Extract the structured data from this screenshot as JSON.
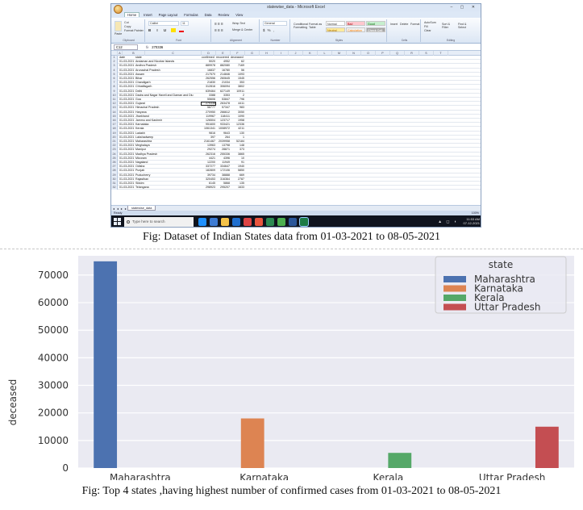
{
  "excel": {
    "window_title": "statewise_data - Microsoft Excel",
    "window_buttons": "– ▢ ✕",
    "ribbon_tabs": [
      "Home",
      "Insert",
      "Page Layout",
      "Formulas",
      "Data",
      "Review",
      "View"
    ],
    "ribbon": {
      "paste": "Paste",
      "cut": "Cut",
      "copy": "Copy",
      "format_painter": "Format Painter",
      "font_name": "Calibri",
      "font_size": "11",
      "wrap_text": "Wrap Text",
      "merge_center": "Merge & Center",
      "number_format": "General",
      "conditional_formatting": "Conditional Formatting",
      "format_as_table": "Format as Table",
      "styles": [
        "Normal",
        "Bad",
        "Good",
        "Neutral",
        "Calculation",
        "Check Cell"
      ],
      "insert": "Insert",
      "delete": "Delete",
      "format": "Format",
      "autosum": "AutoSum",
      "fill": "Fill",
      "clear": "Clear",
      "sort_filter": "Sort & Filter",
      "find_select": "Find & Select",
      "groups": [
        "Clipboard",
        "Font",
        "Alignment",
        "Number",
        "Styles",
        "Cells",
        "Editing"
      ]
    },
    "name_box": "C12",
    "formula_fx": "fx",
    "formula_value": "270336",
    "columns": [
      "A",
      "B",
      "C",
      "D",
      "E",
      "F",
      "G",
      "H",
      "I",
      "J",
      "K",
      "L",
      "M",
      "N",
      "O",
      "P",
      "Q",
      "R",
      "S",
      "T"
    ],
    "header_row": [
      "date",
      "state",
      "confirmed",
      "recovered",
      "deceased"
    ],
    "rows": [
      [
        "01-03-2021",
        "Andaman and Nicobar Islands",
        "5020",
        "4952",
        "62"
      ],
      [
        "01-03-2021",
        "Andhra Pradesh",
        "889978",
        "882080",
        "7169"
      ],
      [
        "01-03-2021",
        "Arunachal Pradesh",
        "16837",
        "16780",
        "56"
      ],
      [
        "01-03-2021",
        "Assam",
        "217570",
        "214846",
        "1093"
      ],
      [
        "01-03-2021",
        "Bihar",
        "262556",
        "260645",
        "1545"
      ],
      [
        "01-03-2021",
        "Chandigarh",
        "21830",
        "21034",
        "353"
      ],
      [
        "01-03-2021",
        "Chhattisgarh",
        "312816",
        "306094",
        "3802"
      ],
      [
        "01-03-2021",
        "Delhi",
        "639464",
        "627149",
        "10911"
      ],
      [
        "01-03-2021",
        "Dadra and Nagar Haveli and Daman and Diu",
        "3388",
        "3353",
        "2"
      ],
      [
        "01-03-2021",
        "Goa",
        "55606",
        "53847",
        "796"
      ],
      [
        "01-03-2021",
        "Gujarat",
        "270336",
        "263478",
        "4411"
      ],
      [
        "01-03-2021",
        "Himachal Pradesh",
        "58777",
        "57347",
        "983"
      ],
      [
        "01-03-2021",
        "Haryana",
        "270950",
        "266612",
        "3050"
      ],
      [
        "01-03-2021",
        "Jharkhand",
        "119967",
        "118411",
        "1090"
      ],
      [
        "01-03-2021",
        "Jammu and Kashmir",
        "126504",
        "123717",
        "1958"
      ],
      [
        "01-03-2021",
        "Karnataka",
        "951600",
        "933421",
        "12336"
      ],
      [
        "01-03-2021",
        "Kerala",
        "1061341",
        "1008972",
        "4211"
      ],
      [
        "01-03-2021",
        "Ladakh",
        "9816",
        "9643",
        "130"
      ],
      [
        "01-03-2021",
        "Lakshadweep",
        "397",
        "264",
        "1"
      ],
      [
        "01-03-2021",
        "Maharashtra",
        "2161467",
        "2039958",
        "52184"
      ],
      [
        "01-03-2021",
        "Meghalaya",
        "13963",
        "13798",
        "148"
      ],
      [
        "01-03-2021",
        "Manipur",
        "29274",
        "28871",
        "373"
      ],
      [
        "01-03-2021",
        "Madhya Pradesh",
        "262316",
        "255336",
        "3865"
      ],
      [
        "01-03-2021",
        "Mizoram",
        "4421",
        "4396",
        "10"
      ],
      [
        "01-03-2021",
        "Nagaland",
        "12200",
        "11949",
        "91"
      ],
      [
        "01-03-2021",
        "Odisha",
        "337277",
        "334647",
        "1940"
      ],
      [
        "01-03-2021",
        "Punjab",
        "182809",
        "172106",
        "5850"
      ],
      [
        "01-03-2021",
        "Puducherry",
        "39734",
        "38888",
        "669"
      ],
      [
        "01-03-2021",
        "Rajasthan",
        "320453",
        "316364",
        "2787"
      ],
      [
        "01-03-2021",
        "Sikkim",
        "6145",
        "5868",
        "135"
      ],
      [
        "01-03-2021",
        "Telangana",
        "298923",
        "295207",
        "1633"
      ]
    ],
    "sheet_nav": "◂ ◂ ▸ ▸",
    "sheet_tab": "statewise_data",
    "status": "Ready",
    "zoom": "100%",
    "taskbar": {
      "search_placeholder": "Type here to search",
      "time": "11:53 AM",
      "date": "07-12-2021"
    }
  },
  "caption_1": "Fig: Dataset of Indian States data from 01-03-2021 to 08-05-2021",
  "caption_2": "Fig: Top 4 states ,having highest number of confirmed cases from 01-03-2021 to 08-05-2021",
  "chart_data": {
    "type": "bar",
    "categories": [
      "Maharashtra",
      "Karnataka",
      "Kerala",
      "Uttar Pradesh"
    ],
    "values": [
      75000,
      18000,
      5500,
      15000
    ],
    "colors": [
      "#4c72b0",
      "#dd8452",
      "#55a868",
      "#c44e52"
    ],
    "xlabel": "state",
    "ylabel": "deceased",
    "ylim": [
      0,
      77000
    ],
    "yticks": [
      0,
      10000,
      20000,
      30000,
      40000,
      50000,
      60000,
      70000
    ],
    "legend_title": "state",
    "legend": [
      "Maharashtra",
      "Karnataka",
      "Kerala",
      "Uttar Pradesh"
    ],
    "legend_placement": "top-right",
    "grid": true,
    "background": "#eaeaf2"
  }
}
